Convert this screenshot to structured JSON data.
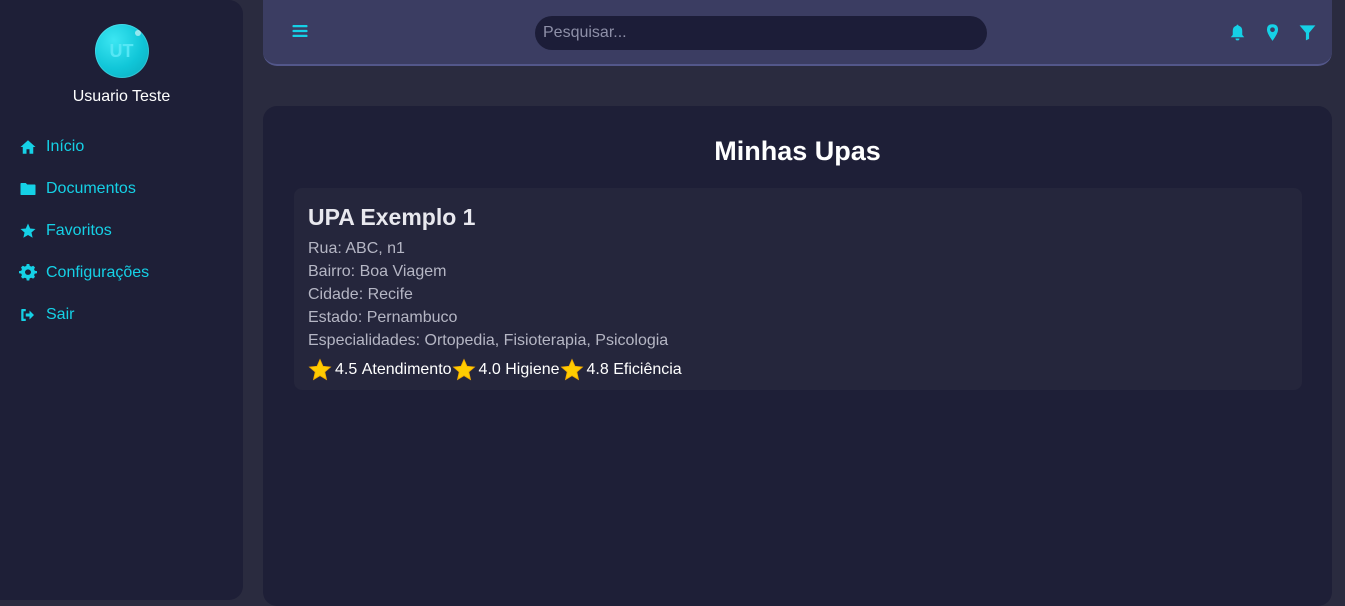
{
  "user": {
    "initials": "UT",
    "name": "Usuario Teste"
  },
  "nav": [
    {
      "label": "Início",
      "icon": "home-icon"
    },
    {
      "label": "Documentos",
      "icon": "folder-icon"
    },
    {
      "label": "Favoritos",
      "icon": "star-icon"
    },
    {
      "label": "Configurações",
      "icon": "gear-icon"
    },
    {
      "label": "Sair",
      "icon": "sign-out-icon"
    }
  ],
  "topbar": {
    "menu_icon": "hamburger-icon",
    "search_placeholder": "Pesquisar...",
    "search_value": "",
    "icons": [
      "bell-icon",
      "map-pin-icon",
      "filter-icon"
    ]
  },
  "main": {
    "title": "Minhas Upas",
    "upas": [
      {
        "name": "UPA Exemplo 1",
        "rua": "Rua: ABC, n1",
        "bairro": "Bairro: Boa Viagem",
        "cidade": "Cidade: Recife",
        "estado": "Estado: Pernambuco",
        "especialidades": "Especialidades: Ortopedia, Fisioterapia, Psicologia",
        "ratings": [
          {
            "value": "4.5",
            "label": "Atendimento"
          },
          {
            "value": "4.0",
            "label": "Higiene"
          },
          {
            "value": "4.8",
            "label": "Eficiência"
          }
        ]
      }
    ]
  },
  "colors": {
    "accent": "#15d1e6",
    "sidebar_bg": "#1e1f37",
    "topbar_bg": "#3b3d62",
    "page_bg": "#2a2b3f",
    "card_bg": "#25263c",
    "star": "#ffcc00"
  }
}
